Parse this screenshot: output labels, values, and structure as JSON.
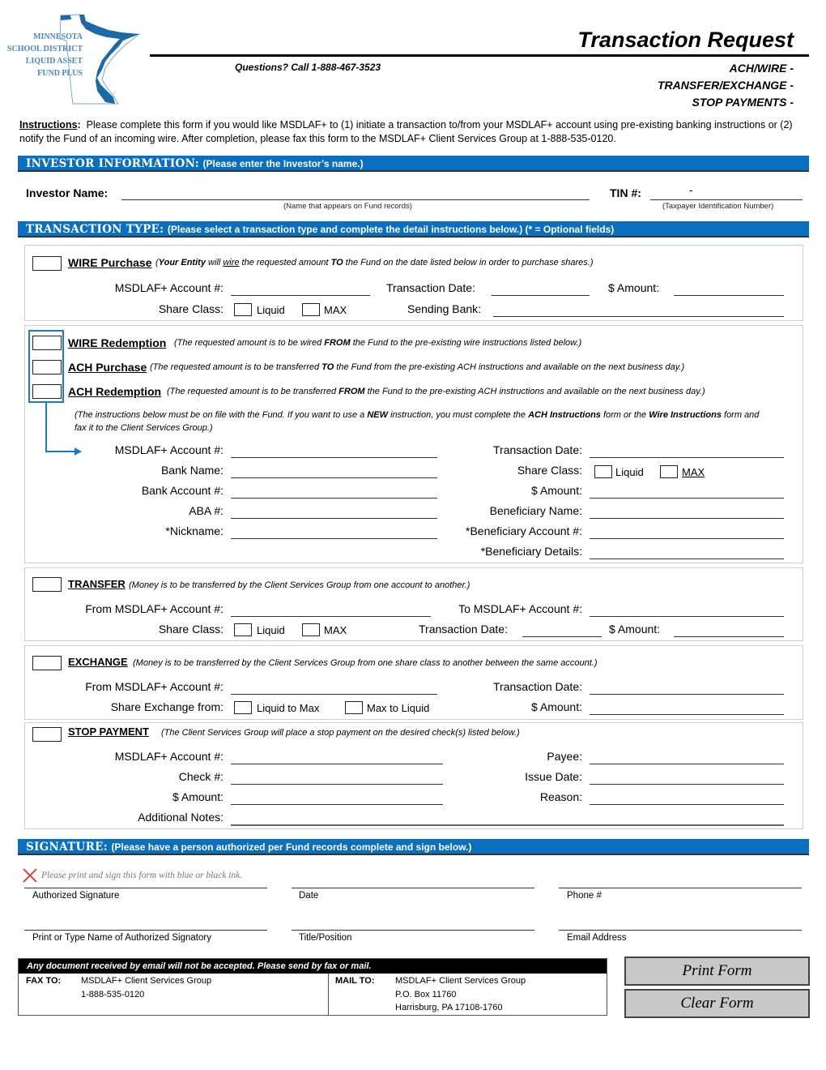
{
  "header": {
    "logo_lines": [
      "MINNESOTA",
      "SCHOOL DISTRICT",
      "LIQUID ASSET",
      "FUND PLUS"
    ],
    "title": "Transaction Request",
    "questions": "Questions? Call 1-888-467-3523",
    "subtitles": [
      "ACH/WIRE -",
      "TRANSFER/EXCHANGE -",
      "STOP PAYMENTS -"
    ]
  },
  "instructions": {
    "label": "Instructions",
    "text": "Please complete this form if you would like MSDLAF+ to (1) initiate a transaction to/from your MSDLAF+ account using pre-existing banking instructions or (2) notify the Fund of an incoming wire.  After completion, please fax this form to the MSDLAF+ Client Services Group at 1-888-535-0120."
  },
  "investor": {
    "bar_title": "INVESTOR INFORMATION:",
    "bar_note": "(Please enter the Investor’s name.)",
    "name_label": "Investor Name:",
    "name_hint": "(Name that appears on Fund records)",
    "tin_label": "TIN #:",
    "tin_value": "-",
    "tin_hint": "(Taxpayer Identification Number)"
  },
  "transaction_type": {
    "bar_title": "TRANSACTION TYPE:",
    "bar_note": "(Please select a transaction type and complete the detail instructions below.) (* = Optional fields)"
  },
  "wire_purchase": {
    "title": "WIRE Purchase",
    "desc_parts": [
      "(",
      "Your Entity",
      " will ",
      "wire",
      " the requested amount ",
      "TO",
      " the Fund on the date listed below in order to purchase shares.)"
    ],
    "account_label": "MSDLAF+ Account #:",
    "date_label": "Transaction Date:",
    "amount_label": "$ Amount:",
    "share_class_label": "Share Class:",
    "liquid": "Liquid",
    "max": "MAX",
    "sending_bank_label": "Sending Bank:"
  },
  "redemption": {
    "wire_redemption": {
      "title": "WIRE Redemption",
      "pre": "(The requested amount is to be wired ",
      "bold": "FROM",
      "post": " the Fund to the pre-existing wire instructions listed below.)"
    },
    "ach_purchase": {
      "title": "ACH Purchase",
      "pre": "(The requested amount is to be transferred ",
      "bold": "TO",
      "post": " the Fund from the pre-existing ACH instructions and available on the next business day.)"
    },
    "ach_redemption": {
      "title": "ACH Redemption",
      "pre": "(The requested amount is to be transferred ",
      "bold": "FROM",
      "post": " the Fund to the pre-existing ACH instructions and available on the next business day.)"
    },
    "note_parts": [
      "(The instructions below must be on file with the Fund.  If you want to use a ",
      "NEW",
      " instruction, you must complete the ",
      "ACH Instructions",
      " form or the ",
      "Wire Instructions",
      " form and fax it to the Client Services Group.)"
    ],
    "left_labels": [
      "MSDLAF+ Account #:",
      "Bank Name:",
      "Bank Account #:",
      "ABA #:",
      "*Nickname:"
    ],
    "right_labels": [
      "Transaction Date:",
      "Share Class:",
      "$ Amount:",
      "Beneficiary Name:",
      "*Beneficiary Account #:",
      "*Beneficiary Details:"
    ],
    "liquid": "Liquid",
    "max": "MAX"
  },
  "transfer": {
    "title": "TRANSFER",
    "desc": "(Money is to be transferred by the Client Services Group from one account to another.)",
    "from_label": "From MSDLAF+ Account #:",
    "to_label": "To MSDLAF+ Account #:",
    "share_class_label": "Share Class:",
    "liquid": "Liquid",
    "max": "MAX",
    "date_label": "Transaction Date:",
    "amount_label": "$ Amount:"
  },
  "exchange": {
    "title": "EXCHANGE",
    "desc": "(Money is to be transferred by the Client Services Group from one share class to another between the same account.)",
    "from_label": "From MSDLAF+ Account #:",
    "date_label": "Transaction Date:",
    "share_exchange_label": "Share Exchange from:",
    "liquid_to_max": "Liquid to Max",
    "max_to_liquid": "Max to Liquid",
    "amount_label": "$ Amount:"
  },
  "stop_payment": {
    "title": "STOP PAYMENT",
    "desc": "(The Client Services Group will place a stop payment on the desired check(s) listed below.)",
    "account_label": "MSDLAF+ Account #:",
    "payee_label": "Payee:",
    "check_label": "Check #:",
    "issue_date_label": "Issue Date:",
    "amount_label": "$ Amount:",
    "reason_label": "Reason:",
    "notes_label": "Additional Notes:"
  },
  "signature": {
    "bar_title": "SIGNATURE:",
    "bar_note": "(Please have a person authorized per Fund records complete and sign below.)",
    "ink_note": "Please print and sign this form with blue or black ink.",
    "row1": [
      "Authorized Signature",
      "Date",
      "Phone #"
    ],
    "row2": [
      "Print or Type Name of Authorized Signatory",
      "Title/Position",
      "Email Address"
    ]
  },
  "footer": {
    "warning": "Any document received by email will not be accepted.  Please send by fax or mail.",
    "fax_label": "FAX TO:",
    "fax_lines": [
      "MSDLAF+ Client Services Group",
      "1-888-535-0120"
    ],
    "mail_label": "MAIL TO:",
    "mail_lines": [
      "MSDLAF+ Client Services Group",
      "P.O. Box 11760",
      "Harrisburg, PA 17108-1760"
    ]
  },
  "buttons": {
    "print": "Print Form",
    "clear": "Clear Form"
  },
  "colors": {
    "section_bar": "#0b6fc0",
    "logo_blue": "#1a6aa8",
    "arrow_blue": "#1a7ad0",
    "sign_x": "#e0302a"
  }
}
